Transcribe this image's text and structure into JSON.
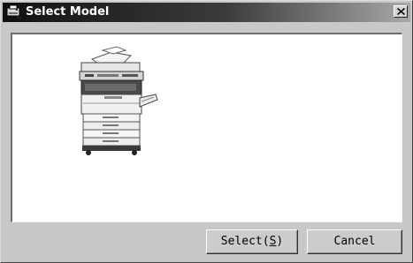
{
  "window": {
    "title": "Select Model",
    "app_icon": "printer-app-icon",
    "close_icon": "close-icon"
  },
  "content": {
    "items": [
      {
        "icon": "copier-machine-icon",
        "label": ""
      }
    ]
  },
  "buttons": {
    "select_prefix": "Select(",
    "select_mnemonic": "S",
    "select_suffix": ")",
    "cancel_label": "Cancel"
  },
  "colors": {
    "title_bar_start": "#101010",
    "title_bar_end": "#a8a8a8",
    "dialog_face": "#c8c8c8",
    "content_bg": "#ffffff"
  }
}
